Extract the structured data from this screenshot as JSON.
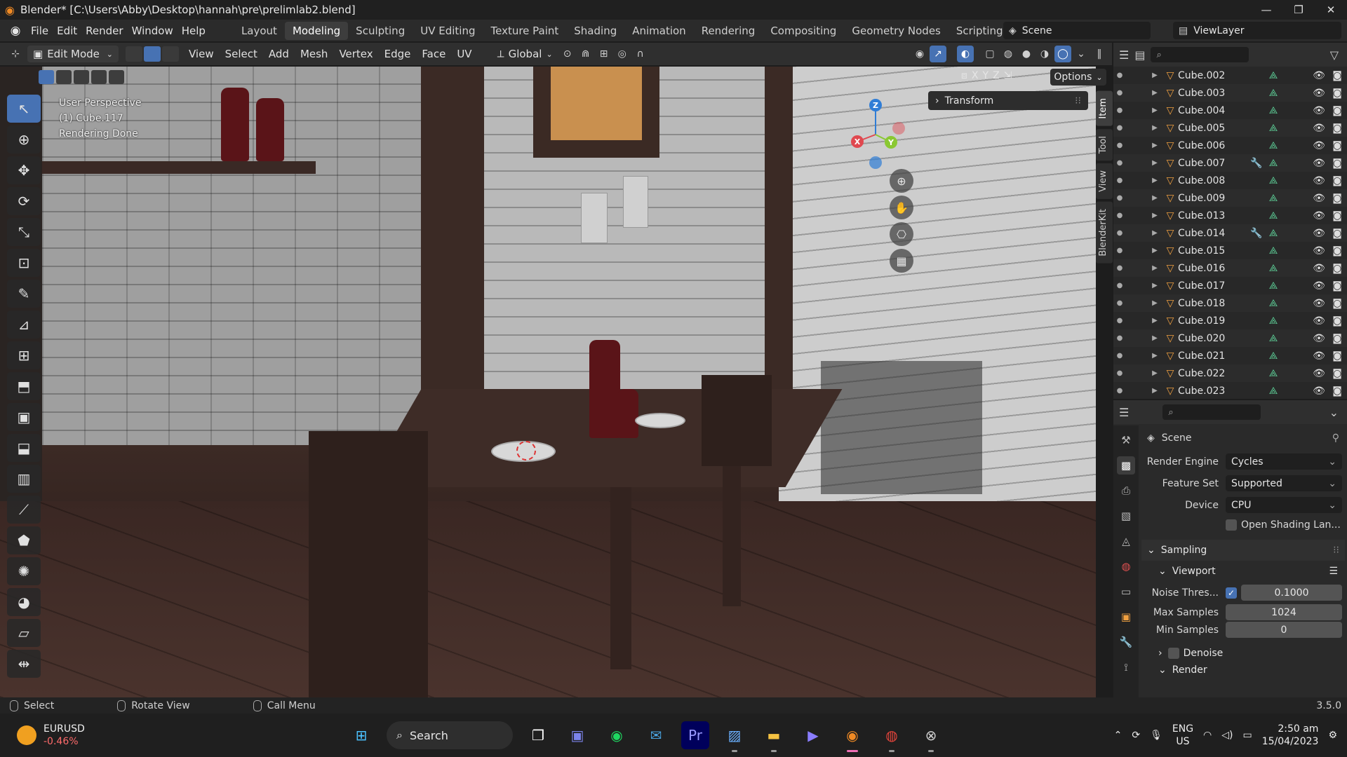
{
  "window": {
    "title": "Blender* [C:\\Users\\Abby\\Desktop\\hannah\\pre\\prelimlab2.blend]",
    "controls": [
      "—",
      "❐",
      "✕"
    ]
  },
  "topbar": {
    "menus": [
      "File",
      "Edit",
      "Render",
      "Window",
      "Help"
    ],
    "workspaces": [
      "Layout",
      "Modeling",
      "Sculpting",
      "UV Editing",
      "Texture Paint",
      "Shading",
      "Animation",
      "Rendering",
      "Compositing",
      "Geometry Nodes",
      "Scripting"
    ],
    "active_workspace": "Modeling",
    "scene": "Scene",
    "view_layer": "ViewLayer"
  },
  "header": {
    "mode": "Edit Mode",
    "menus": [
      "View",
      "Select",
      "Add",
      "Mesh",
      "Vertex",
      "Edge",
      "Face",
      "UV"
    ],
    "transform_orientation": "Global"
  },
  "viewport": {
    "info_lines": [
      "User Perspective",
      "(1) Cube.117",
      "Rendering Done"
    ],
    "axis_labels": [
      "X",
      "Y",
      "Z"
    ],
    "options_label": "Options",
    "transform_panel": "Transform",
    "side_tabs": [
      "Item",
      "Tool",
      "View",
      "BlenderKit"
    ],
    "gizmo": {
      "x": "X",
      "y": "Y",
      "z": "Z"
    }
  },
  "outliner": {
    "items": [
      {
        "name": "Cube.002",
        "modifier": false
      },
      {
        "name": "Cube.003",
        "modifier": false
      },
      {
        "name": "Cube.004",
        "modifier": false
      },
      {
        "name": "Cube.005",
        "modifier": false
      },
      {
        "name": "Cube.006",
        "modifier": false
      },
      {
        "name": "Cube.007",
        "modifier": true
      },
      {
        "name": "Cube.008",
        "modifier": false
      },
      {
        "name": "Cube.009",
        "modifier": false
      },
      {
        "name": "Cube.013",
        "modifier": false
      },
      {
        "name": "Cube.014",
        "modifier": true
      },
      {
        "name": "Cube.015",
        "modifier": false
      },
      {
        "name": "Cube.016",
        "modifier": false
      },
      {
        "name": "Cube.017",
        "modifier": false
      },
      {
        "name": "Cube.018",
        "modifier": false
      },
      {
        "name": "Cube.019",
        "modifier": false
      },
      {
        "name": "Cube.020",
        "modifier": false
      },
      {
        "name": "Cube.021",
        "modifier": false
      },
      {
        "name": "Cube.022",
        "modifier": false
      },
      {
        "name": "Cube.023",
        "modifier": false
      }
    ]
  },
  "properties": {
    "context": "Scene",
    "render_engine_label": "Render Engine",
    "render_engine": "Cycles",
    "feature_set_label": "Feature Set",
    "feature_set": "Supported",
    "device_label": "Device",
    "device": "CPU",
    "osl_label": "Open Shading Lan...",
    "sampling_label": "Sampling",
    "viewport_label": "Viewport",
    "noise_threshold_label": "Noise Thres...",
    "noise_threshold": "0.1000",
    "max_samples_label": "Max Samples",
    "max_samples": "1024",
    "min_samples_label": "Min Samples",
    "min_samples": "0",
    "denoise_label": "Denoise",
    "render_label": "Render"
  },
  "statusbar": {
    "select": "Select",
    "rotate": "Rotate View",
    "call_menu": "Call Menu",
    "version": "3.5.0"
  },
  "taskbar": {
    "ticker_symbol": "EURUSD",
    "ticker_change": "-0.46%",
    "search_label": "Search",
    "lang_line1": "ENG",
    "lang_line2": "US",
    "time": "2:50 am",
    "date": "15/04/2023"
  }
}
